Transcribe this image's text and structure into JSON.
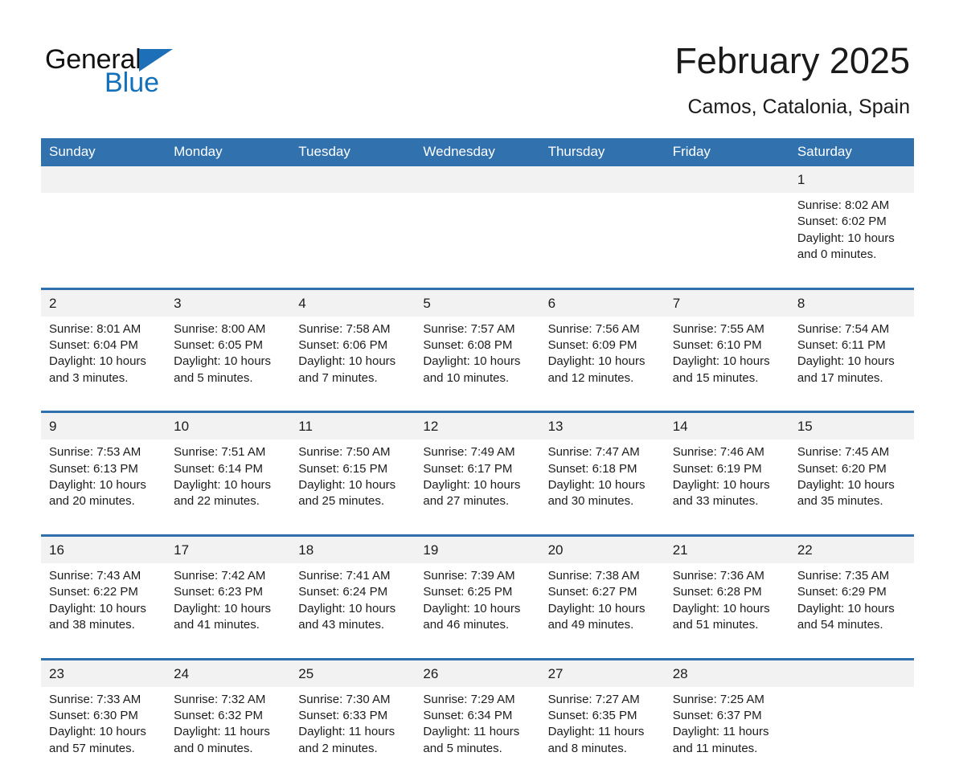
{
  "brand": {
    "name_part1": "General",
    "name_part2": "Blue",
    "triangle_icon": "triangle-icon",
    "triangle_color": "#1d70b7",
    "blue_color": "#1371bb"
  },
  "header": {
    "title": "February 2025",
    "subtitle": "Camos, Catalonia, Spain"
  },
  "theme": {
    "header_blue": "#3071ae",
    "separator_blue": "#2e6fac",
    "daynum_band": "#f2f2f2",
    "text": "#1c1c1c"
  },
  "calendar": {
    "weekday_headers": [
      "Sunday",
      "Monday",
      "Tuesday",
      "Wednesday",
      "Thursday",
      "Friday",
      "Saturday"
    ],
    "weeks": [
      [
        {
          "day": "",
          "sunrise": "",
          "sunset": "",
          "daylight_line1": "",
          "daylight_line2": ""
        },
        {
          "day": "",
          "sunrise": "",
          "sunset": "",
          "daylight_line1": "",
          "daylight_line2": ""
        },
        {
          "day": "",
          "sunrise": "",
          "sunset": "",
          "daylight_line1": "",
          "daylight_line2": ""
        },
        {
          "day": "",
          "sunrise": "",
          "sunset": "",
          "daylight_line1": "",
          "daylight_line2": ""
        },
        {
          "day": "",
          "sunrise": "",
          "sunset": "",
          "daylight_line1": "",
          "daylight_line2": ""
        },
        {
          "day": "",
          "sunrise": "",
          "sunset": "",
          "daylight_line1": "",
          "daylight_line2": ""
        },
        {
          "day": "1",
          "sunrise": "Sunrise: 8:02 AM",
          "sunset": "Sunset: 6:02 PM",
          "daylight_line1": "Daylight: 10 hours",
          "daylight_line2": "and 0 minutes."
        }
      ],
      [
        {
          "day": "2",
          "sunrise": "Sunrise: 8:01 AM",
          "sunset": "Sunset: 6:04 PM",
          "daylight_line1": "Daylight: 10 hours",
          "daylight_line2": "and 3 minutes."
        },
        {
          "day": "3",
          "sunrise": "Sunrise: 8:00 AM",
          "sunset": "Sunset: 6:05 PM",
          "daylight_line1": "Daylight: 10 hours",
          "daylight_line2": "and 5 minutes."
        },
        {
          "day": "4",
          "sunrise": "Sunrise: 7:58 AM",
          "sunset": "Sunset: 6:06 PM",
          "daylight_line1": "Daylight: 10 hours",
          "daylight_line2": "and 7 minutes."
        },
        {
          "day": "5",
          "sunrise": "Sunrise: 7:57 AM",
          "sunset": "Sunset: 6:08 PM",
          "daylight_line1": "Daylight: 10 hours",
          "daylight_line2": "and 10 minutes."
        },
        {
          "day": "6",
          "sunrise": "Sunrise: 7:56 AM",
          "sunset": "Sunset: 6:09 PM",
          "daylight_line1": "Daylight: 10 hours",
          "daylight_line2": "and 12 minutes."
        },
        {
          "day": "7",
          "sunrise": "Sunrise: 7:55 AM",
          "sunset": "Sunset: 6:10 PM",
          "daylight_line1": "Daylight: 10 hours",
          "daylight_line2": "and 15 minutes."
        },
        {
          "day": "8",
          "sunrise": "Sunrise: 7:54 AM",
          "sunset": "Sunset: 6:11 PM",
          "daylight_line1": "Daylight: 10 hours",
          "daylight_line2": "and 17 minutes."
        }
      ],
      [
        {
          "day": "9",
          "sunrise": "Sunrise: 7:53 AM",
          "sunset": "Sunset: 6:13 PM",
          "daylight_line1": "Daylight: 10 hours",
          "daylight_line2": "and 20 minutes."
        },
        {
          "day": "10",
          "sunrise": "Sunrise: 7:51 AM",
          "sunset": "Sunset: 6:14 PM",
          "daylight_line1": "Daylight: 10 hours",
          "daylight_line2": "and 22 minutes."
        },
        {
          "day": "11",
          "sunrise": "Sunrise: 7:50 AM",
          "sunset": "Sunset: 6:15 PM",
          "daylight_line1": "Daylight: 10 hours",
          "daylight_line2": "and 25 minutes."
        },
        {
          "day": "12",
          "sunrise": "Sunrise: 7:49 AM",
          "sunset": "Sunset: 6:17 PM",
          "daylight_line1": "Daylight: 10 hours",
          "daylight_line2": "and 27 minutes."
        },
        {
          "day": "13",
          "sunrise": "Sunrise: 7:47 AM",
          "sunset": "Sunset: 6:18 PM",
          "daylight_line1": "Daylight: 10 hours",
          "daylight_line2": "and 30 minutes."
        },
        {
          "day": "14",
          "sunrise": "Sunrise: 7:46 AM",
          "sunset": "Sunset: 6:19 PM",
          "daylight_line1": "Daylight: 10 hours",
          "daylight_line2": "and 33 minutes."
        },
        {
          "day": "15",
          "sunrise": "Sunrise: 7:45 AM",
          "sunset": "Sunset: 6:20 PM",
          "daylight_line1": "Daylight: 10 hours",
          "daylight_line2": "and 35 minutes."
        }
      ],
      [
        {
          "day": "16",
          "sunrise": "Sunrise: 7:43 AM",
          "sunset": "Sunset: 6:22 PM",
          "daylight_line1": "Daylight: 10 hours",
          "daylight_line2": "and 38 minutes."
        },
        {
          "day": "17",
          "sunrise": "Sunrise: 7:42 AM",
          "sunset": "Sunset: 6:23 PM",
          "daylight_line1": "Daylight: 10 hours",
          "daylight_line2": "and 41 minutes."
        },
        {
          "day": "18",
          "sunrise": "Sunrise: 7:41 AM",
          "sunset": "Sunset: 6:24 PM",
          "daylight_line1": "Daylight: 10 hours",
          "daylight_line2": "and 43 minutes."
        },
        {
          "day": "19",
          "sunrise": "Sunrise: 7:39 AM",
          "sunset": "Sunset: 6:25 PM",
          "daylight_line1": "Daylight: 10 hours",
          "daylight_line2": "and 46 minutes."
        },
        {
          "day": "20",
          "sunrise": "Sunrise: 7:38 AM",
          "sunset": "Sunset: 6:27 PM",
          "daylight_line1": "Daylight: 10 hours",
          "daylight_line2": "and 49 minutes."
        },
        {
          "day": "21",
          "sunrise": "Sunrise: 7:36 AM",
          "sunset": "Sunset: 6:28 PM",
          "daylight_line1": "Daylight: 10 hours",
          "daylight_line2": "and 51 minutes."
        },
        {
          "day": "22",
          "sunrise": "Sunrise: 7:35 AM",
          "sunset": "Sunset: 6:29 PM",
          "daylight_line1": "Daylight: 10 hours",
          "daylight_line2": "and 54 minutes."
        }
      ],
      [
        {
          "day": "23",
          "sunrise": "Sunrise: 7:33 AM",
          "sunset": "Sunset: 6:30 PM",
          "daylight_line1": "Daylight: 10 hours",
          "daylight_line2": "and 57 minutes."
        },
        {
          "day": "24",
          "sunrise": "Sunrise: 7:32 AM",
          "sunset": "Sunset: 6:32 PM",
          "daylight_line1": "Daylight: 11 hours",
          "daylight_line2": "and 0 minutes."
        },
        {
          "day": "25",
          "sunrise": "Sunrise: 7:30 AM",
          "sunset": "Sunset: 6:33 PM",
          "daylight_line1": "Daylight: 11 hours",
          "daylight_line2": "and 2 minutes."
        },
        {
          "day": "26",
          "sunrise": "Sunrise: 7:29 AM",
          "sunset": "Sunset: 6:34 PM",
          "daylight_line1": "Daylight: 11 hours",
          "daylight_line2": "and 5 minutes."
        },
        {
          "day": "27",
          "sunrise": "Sunrise: 7:27 AM",
          "sunset": "Sunset: 6:35 PM",
          "daylight_line1": "Daylight: 11 hours",
          "daylight_line2": "and 8 minutes."
        },
        {
          "day": "28",
          "sunrise": "Sunrise: 7:25 AM",
          "sunset": "Sunset: 6:37 PM",
          "daylight_line1": "Daylight: 11 hours",
          "daylight_line2": "and 11 minutes."
        },
        {
          "day": "",
          "sunrise": "",
          "sunset": "",
          "daylight_line1": "",
          "daylight_line2": ""
        }
      ]
    ]
  }
}
